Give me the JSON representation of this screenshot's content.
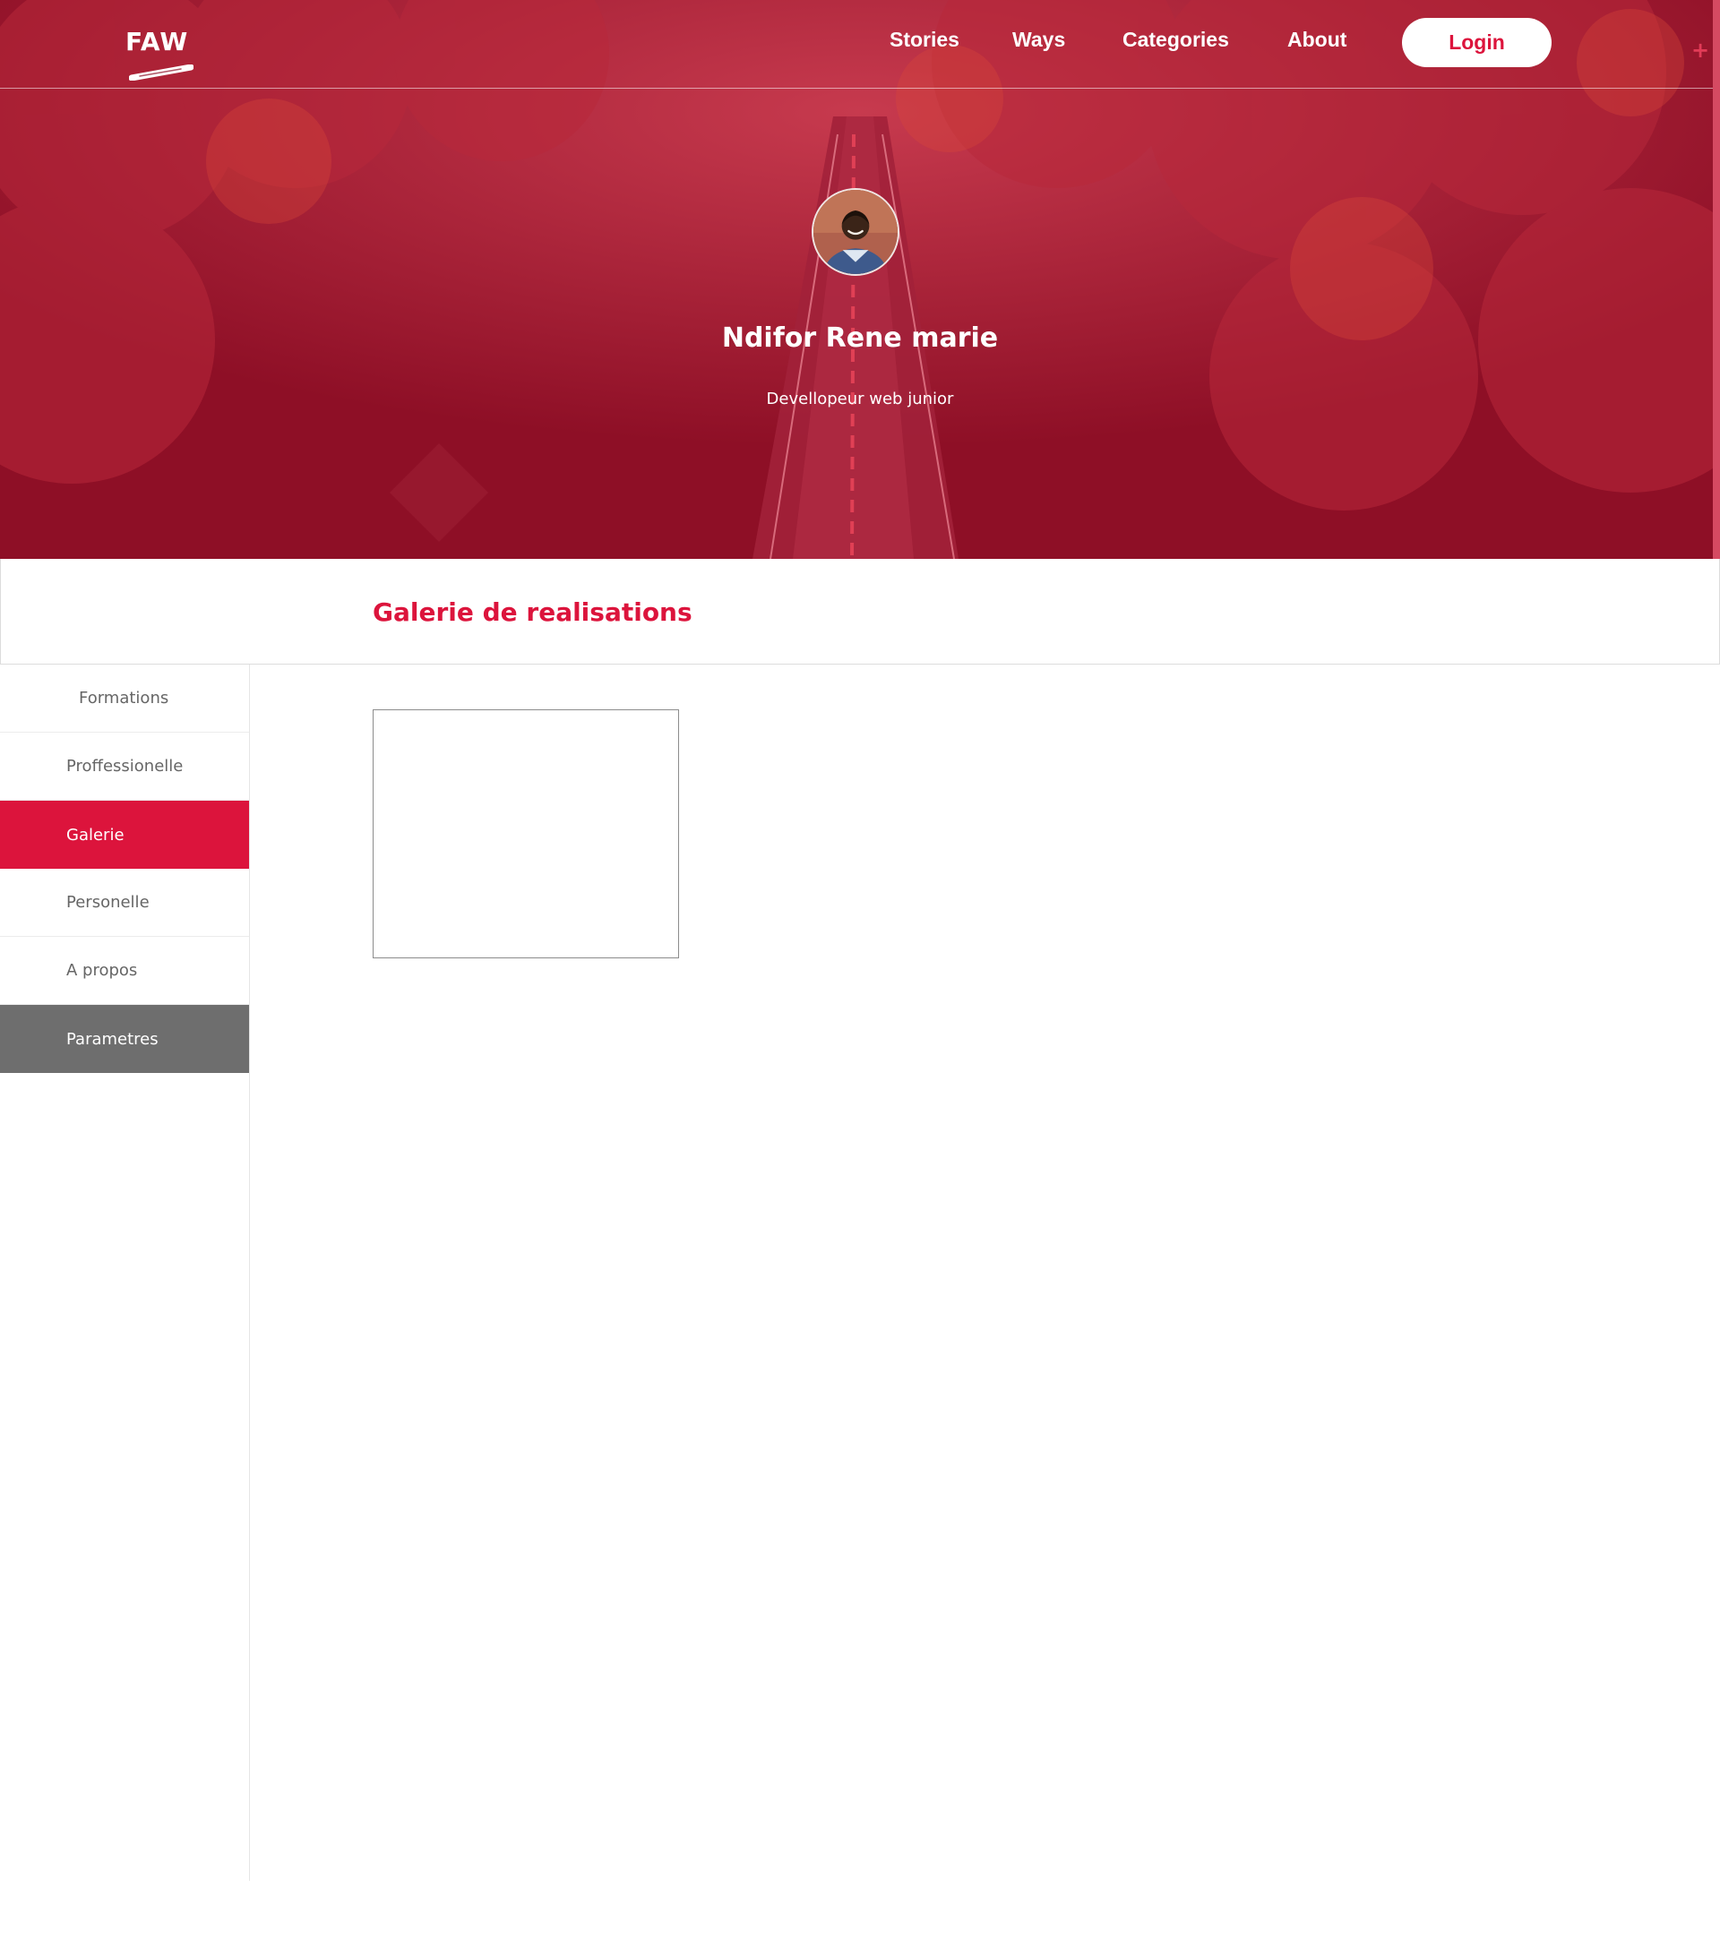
{
  "brand": {
    "logo_text": "FAW"
  },
  "nav": {
    "links": [
      "Stories",
      "Ways",
      "Categories",
      "About"
    ],
    "login_label": "Login"
  },
  "profile": {
    "name": "Ndifor Rene marie",
    "role": "Devellopeur web junior"
  },
  "section": {
    "title": "Galerie de realisations"
  },
  "sidebar": {
    "items": [
      {
        "label": "Formations",
        "state": "default"
      },
      {
        "label": "Proffessionelle",
        "state": "default"
      },
      {
        "label": "Galerie",
        "state": "active"
      },
      {
        "label": "Personelle",
        "state": "default"
      },
      {
        "label": "A propos",
        "state": "default"
      },
      {
        "label": "Parametres",
        "state": "dark"
      }
    ]
  },
  "colors": {
    "accent": "#dc143c",
    "hero_overlay": "#8e0f26",
    "sidebar_dark": "#6e6e6e",
    "text_muted": "#666666"
  },
  "icons": {
    "avatar": "user-avatar-photo",
    "logo_underline": "brush-stroke"
  }
}
